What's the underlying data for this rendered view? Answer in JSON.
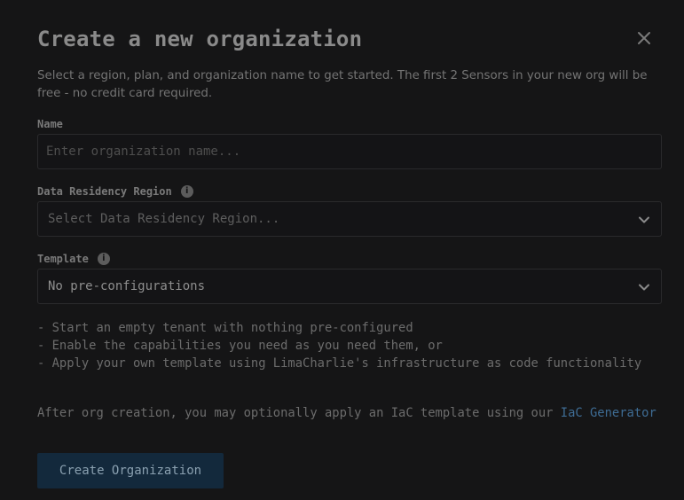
{
  "dialog": {
    "title": "Create a new organization",
    "description": "Select a region, plan, and organization name to get started. The first 2 Sensors in your new org will be free - no credit card required."
  },
  "form": {
    "name": {
      "label": "Name",
      "placeholder": "Enter organization name...",
      "value": ""
    },
    "region": {
      "label": "Data Residency Region",
      "placeholder": "Select Data Residency Region..."
    },
    "template": {
      "label": "Template",
      "value": "No pre-configurations"
    }
  },
  "template_info": {
    "lines": [
      "- Start an empty tenant with nothing pre-configured",
      "- Enable the capabilities you need as you need them, or",
      "- Apply your own template using LimaCharlie's infrastructure as code functionality"
    ],
    "after_text": "After org creation, you may optionally apply an IaC template using our ",
    "link_text": "IaC Generator"
  },
  "actions": {
    "create_label": "Create Organization"
  },
  "icons": {
    "close": "close-icon",
    "info": "info-icon",
    "chevron": "chevron-down-icon"
  },
  "colors": {
    "background": "#151516",
    "link": "#3e6c94",
    "primary_button": "#13293c"
  }
}
